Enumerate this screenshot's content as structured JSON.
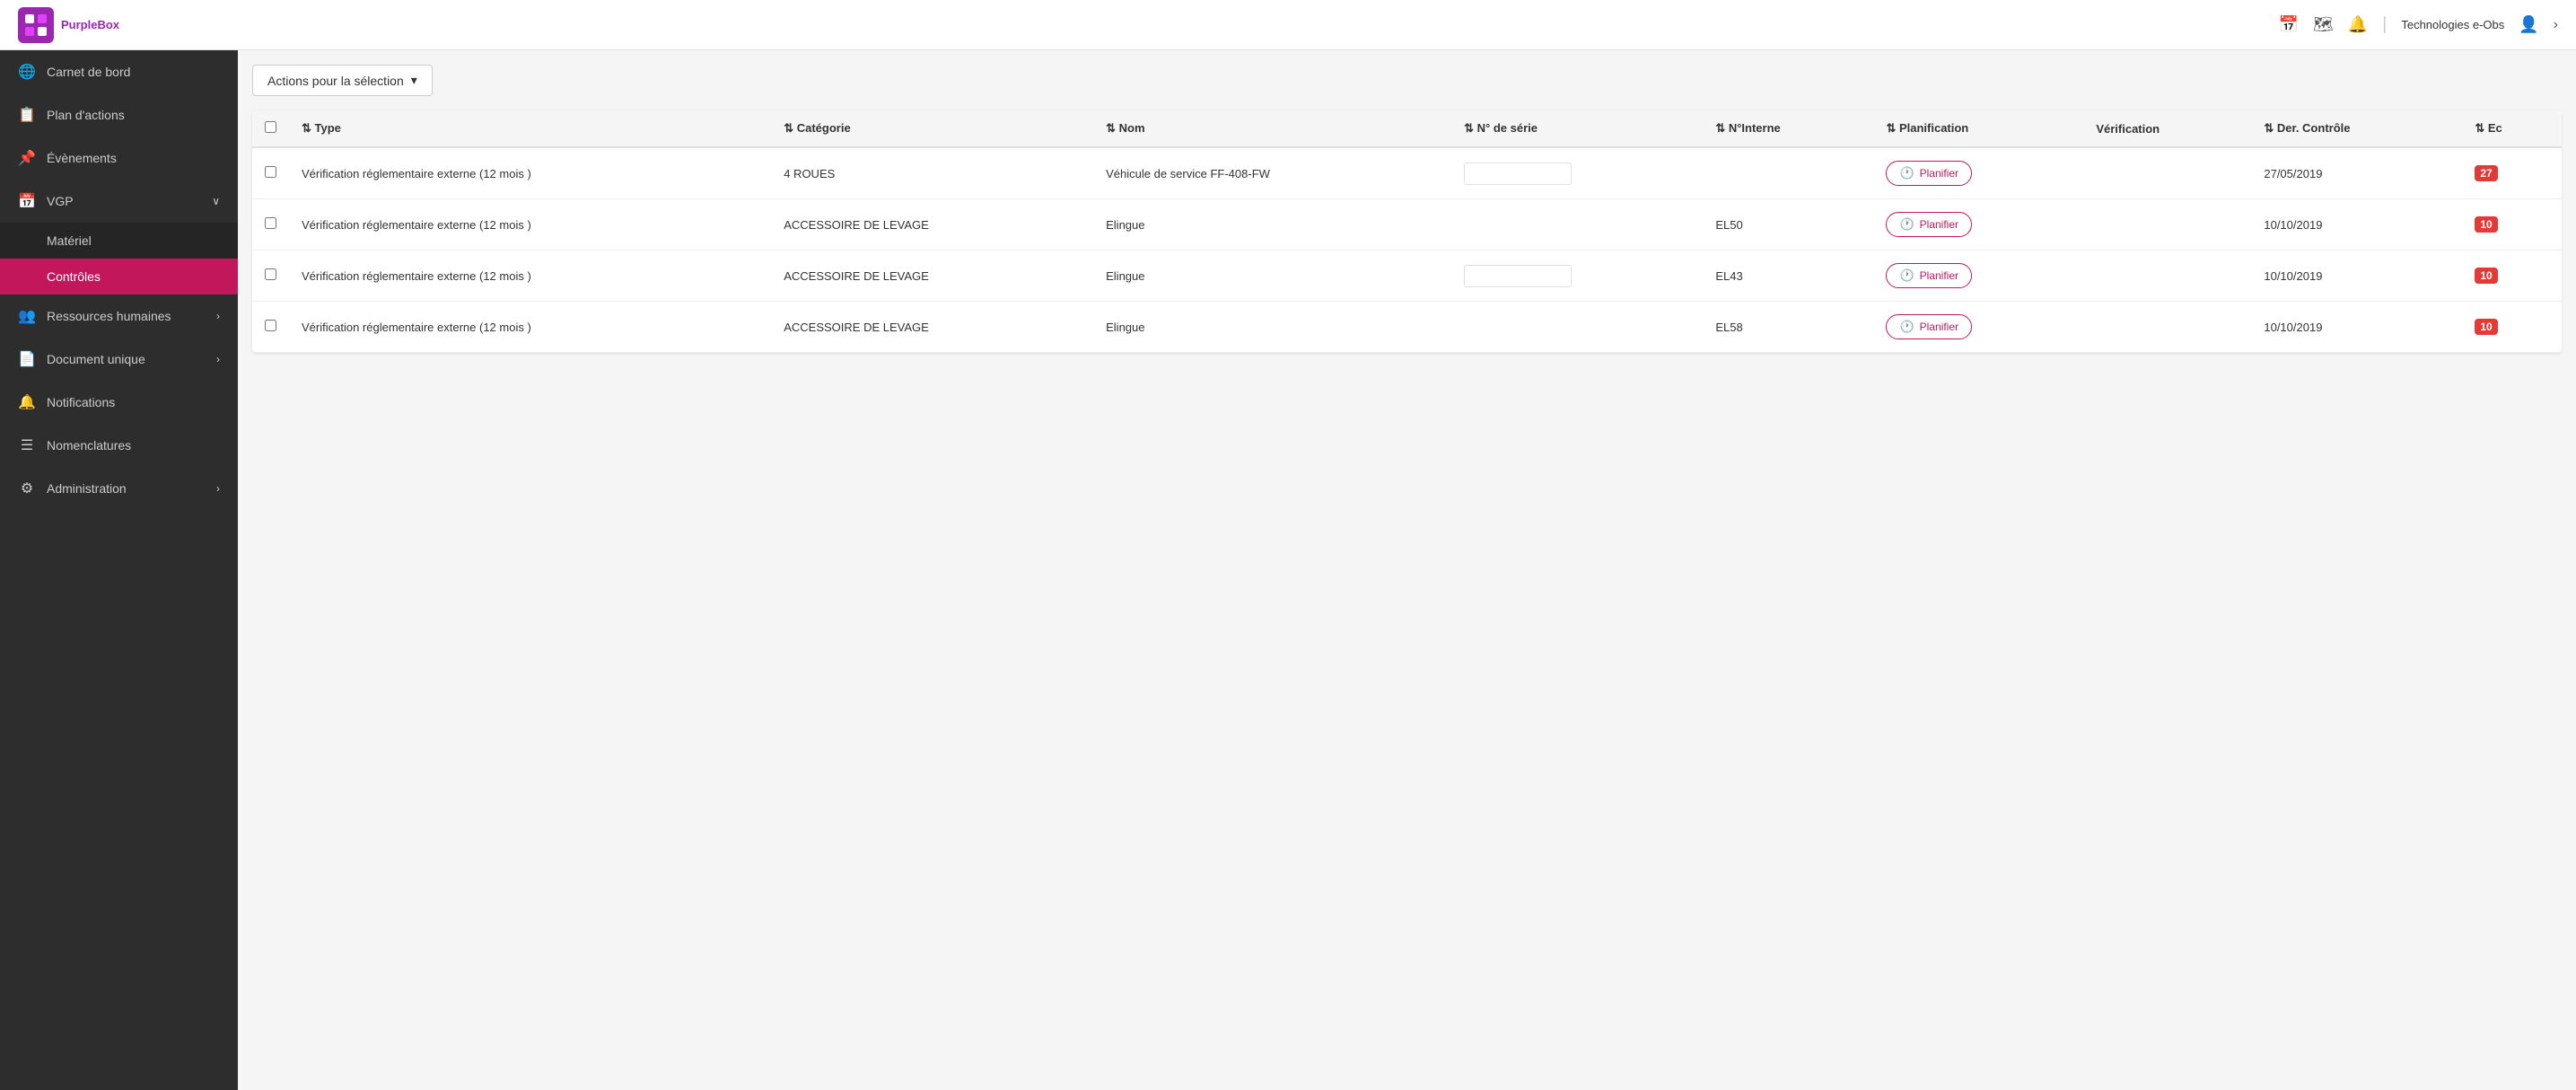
{
  "logo": {
    "text": "PurpleBox",
    "icon_color": "#9b27b0"
  },
  "header": {
    "company": "Technologies e-Obs",
    "icons": {
      "calendar": "📅",
      "map": "🗺",
      "bell": "🔔",
      "user": "👤",
      "chevron": "›"
    }
  },
  "sidebar": {
    "items": [
      {
        "id": "carnet",
        "label": "Carnet de bord",
        "icon": "🌐",
        "has_chevron": false,
        "active": false
      },
      {
        "id": "plan",
        "label": "Plan d'actions",
        "icon": "📋",
        "has_chevron": false,
        "active": false
      },
      {
        "id": "evenements",
        "label": "Évènements",
        "icon": "📌",
        "has_chevron": false,
        "active": false
      },
      {
        "id": "vgp",
        "label": "VGP",
        "icon": "📅",
        "has_chevron": true,
        "active": false
      },
      {
        "id": "materiel",
        "label": "Matériel",
        "icon": "",
        "sub": true,
        "active": false
      },
      {
        "id": "controles",
        "label": "Contrôles",
        "icon": "",
        "sub": true,
        "active": true
      },
      {
        "id": "ressources",
        "label": "Ressources humaines",
        "icon": "👥",
        "has_chevron": true,
        "active": false
      },
      {
        "id": "document",
        "label": "Document unique",
        "icon": "📄",
        "has_chevron": true,
        "active": false
      },
      {
        "id": "notifications",
        "label": "Notifications",
        "icon": "🔔",
        "has_chevron": false,
        "active": false
      },
      {
        "id": "nomenclatures",
        "label": "Nomenclatures",
        "icon": "☰",
        "has_chevron": false,
        "active": false
      },
      {
        "id": "administration",
        "label": "Administration",
        "icon": "⚙",
        "has_chevron": true,
        "active": false
      }
    ]
  },
  "actions_button": {
    "label": "Actions pour la sélection",
    "dropdown_icon": "▾"
  },
  "table": {
    "columns": [
      {
        "id": "checkbox",
        "label": "",
        "sortable": false
      },
      {
        "id": "type",
        "label": "Type",
        "sortable": true
      },
      {
        "id": "categorie",
        "label": "Catégorie",
        "sortable": true
      },
      {
        "id": "nom",
        "label": "Nom",
        "sortable": true
      },
      {
        "id": "nserie",
        "label": "N° de série",
        "sortable": true
      },
      {
        "id": "ninterne",
        "label": "N°Interne",
        "sortable": false
      },
      {
        "id": "planification",
        "label": "Planification",
        "sortable": true
      },
      {
        "id": "verification",
        "label": "Vérification",
        "sortable": false
      },
      {
        "id": "dercontrole",
        "label": "Der. Contrôle",
        "sortable": true
      },
      {
        "id": "ec",
        "label": "Ec",
        "sortable": false
      }
    ],
    "rows": [
      {
        "type": "Vérification réglementaire externe (12 mois )",
        "categorie": "4 ROUES",
        "nom": "Véhicule de service FF-408-FW",
        "nserie_input": true,
        "nserie_value": "",
        "ninterne": "",
        "planification_btn": "Planifier",
        "verification": "",
        "dercontrole": "27/05/2019",
        "ec_value": "27",
        "ec_color": "#e53935"
      },
      {
        "type": "Vérification réglementaire externe (12 mois )",
        "categorie": "ACCESSOIRE DE LEVAGE",
        "nom": "Elingue",
        "nserie_input": false,
        "nserie_value": "",
        "ninterne": "EL50",
        "planification_btn": "Planifier",
        "verification": "",
        "dercontrole": "10/10/2019",
        "ec_value": "10",
        "ec_color": "#e53935"
      },
      {
        "type": "Vérification réglementaire externe (12 mois )",
        "categorie": "ACCESSOIRE DE LEVAGE",
        "nom": "Elingue",
        "nserie_input": true,
        "nserie_value": "",
        "ninterne": "EL43",
        "planification_btn": "Planifier",
        "verification": "",
        "dercontrole": "10/10/2019",
        "ec_value": "10",
        "ec_color": "#e53935"
      },
      {
        "type": "Vérification réglementaire externe (12 mois )",
        "categorie": "ACCESSOIRE DE LEVAGE",
        "nom": "Elingue",
        "nserie_input": false,
        "nserie_value": "",
        "ninterne": "EL58",
        "planification_btn": "Planifier",
        "verification": "",
        "dercontrole": "10/10/2019",
        "ec_value": "10",
        "ec_color": "#e53935"
      }
    ]
  }
}
